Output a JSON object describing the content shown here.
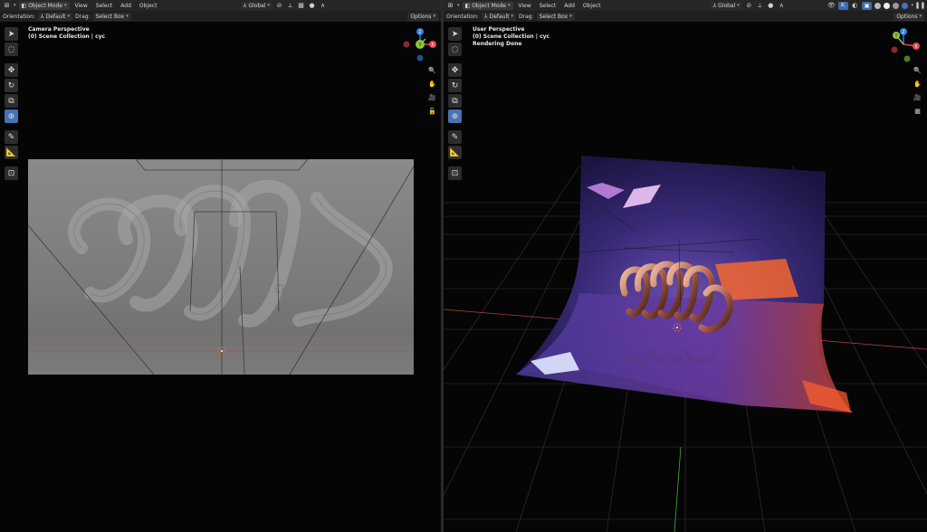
{
  "left": {
    "header": {
      "mode": "Object Mode",
      "menus": [
        "View",
        "Select",
        "Add",
        "Object"
      ],
      "transform": "Global"
    },
    "subheader": {
      "orientation_label": "Orientation:",
      "orientation_value": "Default",
      "drag_label": "Drag:",
      "drag_value": "Select Box",
      "options": "Options"
    },
    "overlay": {
      "line1": "Camera Perspective",
      "line2": "(0) Scene Collection | cyc"
    }
  },
  "right": {
    "header": {
      "mode": "Object Mode",
      "menus": [
        "View",
        "Select",
        "Add",
        "Object"
      ],
      "transform": "Global"
    },
    "subheader": {
      "orientation_label": "Orientation:",
      "orientation_value": "Default",
      "drag_label": "Drag:",
      "drag_value": "Select Box",
      "options": "Options"
    },
    "overlay": {
      "line1": "User Perspective",
      "line2": "(0) Scene Collection | cyc",
      "line3": "Rendering Done"
    }
  },
  "gizmo": {
    "x": "X",
    "y": "Y",
    "z": "Z"
  },
  "colors": {
    "accent": "#4772b3",
    "axis_x": "#e54554",
    "axis_y": "#8cc63f",
    "axis_z": "#2f7cdc"
  },
  "icons": {
    "toolbar": [
      "select-icon",
      "cursor-icon",
      "move-icon",
      "rotate-icon",
      "scale-icon",
      "transform-icon",
      "annotate-icon",
      "measure-icon",
      "add-cube-icon"
    ],
    "nav": [
      "zoom-icon",
      "hand-icon",
      "camera-icon",
      "lock-icon",
      "grid-icon"
    ]
  }
}
